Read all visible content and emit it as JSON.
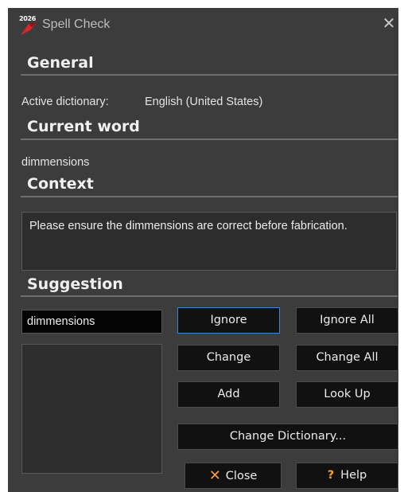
{
  "window": {
    "title": "Spell Check",
    "icon_year": "2026",
    "close_glyph": "✕"
  },
  "general": {
    "heading": "General",
    "active_dictionary_label": "Active dictionary:",
    "active_dictionary_value": "English (United States)"
  },
  "current_word": {
    "heading": "Current word",
    "value": "dimmensions"
  },
  "context": {
    "heading": "Context",
    "text": "Please ensure the dimmensions are correct before fabrication."
  },
  "suggestion": {
    "heading": "Suggestion",
    "input_value": "dimmensions",
    "list_items": []
  },
  "buttons": {
    "ignore": "Ignore",
    "ignore_all": "Ignore All",
    "change": "Change",
    "change_all": "Change All",
    "add": "Add",
    "look_up": "Look Up",
    "change_dictionary": "Change Dictionary...",
    "close": "Close",
    "help": "Help"
  },
  "colors": {
    "background": "#3c3c3c",
    "accent_orange": "#ff9a2e",
    "focus_border": "#4a80c8"
  }
}
